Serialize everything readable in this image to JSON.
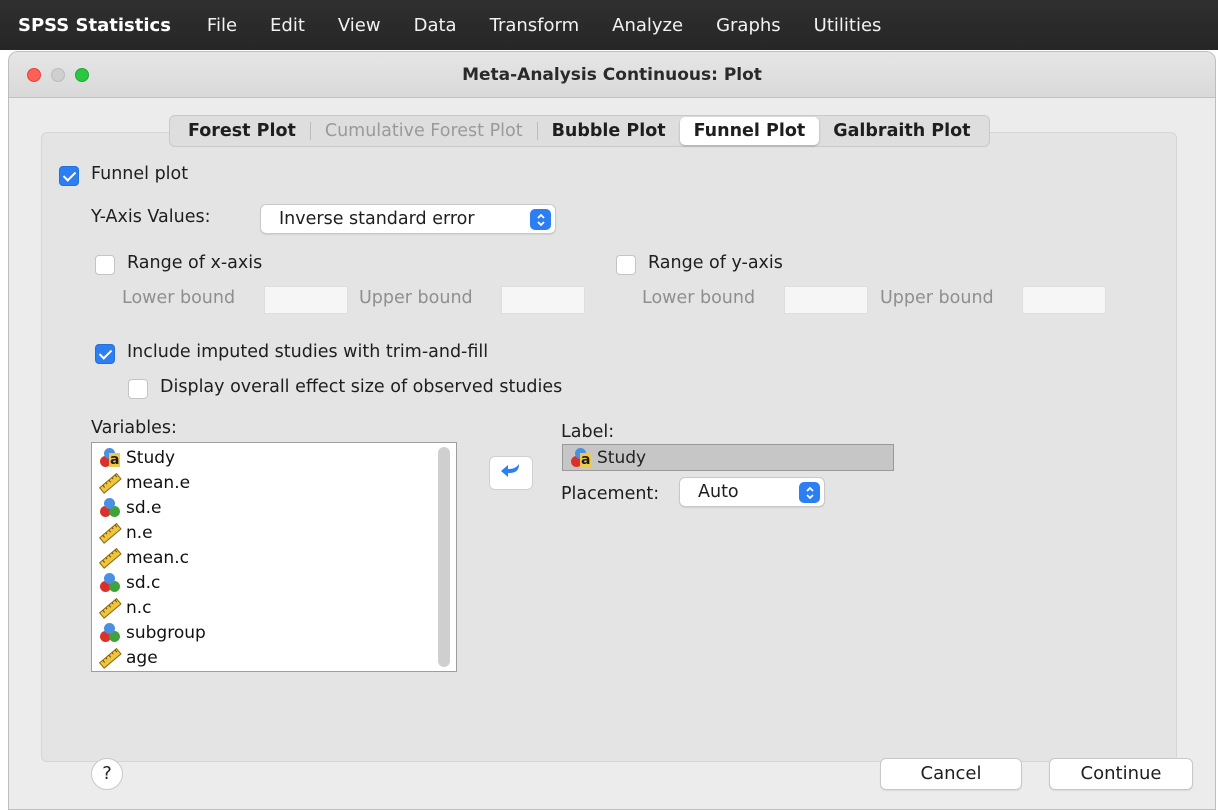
{
  "menubar": {
    "app": "SPSS Statistics",
    "items": [
      "File",
      "Edit",
      "View",
      "Data",
      "Transform",
      "Analyze",
      "Graphs",
      "Utilities"
    ]
  },
  "window": {
    "title": "Meta-Analysis Continuous: Plot"
  },
  "tabs": [
    {
      "label": "Forest Plot",
      "state": "enabled"
    },
    {
      "label": "Cumulative Forest Plot",
      "state": "disabled"
    },
    {
      "label": "Bubble Plot",
      "state": "enabled"
    },
    {
      "label": "Funnel Plot",
      "state": "active"
    },
    {
      "label": "Galbraith Plot",
      "state": "enabled"
    }
  ],
  "funnel": {
    "enable_label": "Funnel plot",
    "enable_checked": true,
    "yaxis_label": "Y-Axis Values:",
    "yaxis_value": "Inverse standard error",
    "range_x_label": "Range of x-axis",
    "range_x_checked": false,
    "range_y_label": "Range of y-axis",
    "range_y_checked": false,
    "lower_bound": "Lower bound",
    "upper_bound": "Upper bound",
    "trimfill_label": "Include imputed studies with trim-and-fill",
    "trimfill_checked": true,
    "observed_label": "Display overall effect size of observed studies",
    "observed_checked": false
  },
  "variables": {
    "heading": "Variables:",
    "items": [
      {
        "name": "Study",
        "icon": "nominal-string-icon"
      },
      {
        "name": "mean.e",
        "icon": "scale-ruler-icon"
      },
      {
        "name": "sd.e",
        "icon": "nominal-icon"
      },
      {
        "name": "n.e",
        "icon": "scale-ruler-icon"
      },
      {
        "name": "mean.c",
        "icon": "scale-ruler-icon"
      },
      {
        "name": "sd.c",
        "icon": "nominal-icon"
      },
      {
        "name": "n.c",
        "icon": "scale-ruler-icon"
      },
      {
        "name": "subgroup",
        "icon": "nominal-icon"
      },
      {
        "name": "age",
        "icon": "scale-ruler-icon"
      }
    ]
  },
  "labelField": {
    "heading": "Label:",
    "value": "Study",
    "placement_label": "Placement:",
    "placement_value": "Auto"
  },
  "buttons": {
    "help": "?",
    "cancel": "Cancel",
    "continue": "Continue"
  },
  "colors": {
    "accent": "#2b7ff3",
    "menubar": "#2b2b2b"
  }
}
